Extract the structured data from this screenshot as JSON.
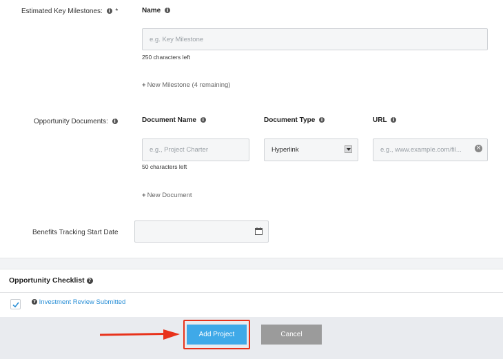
{
  "milestones": {
    "label": "Estimated Key Milestones:",
    "required_mark": "*",
    "name_header": "Name",
    "name_placeholder": "e.g. Key Milestone",
    "chars_left": "250 characters left",
    "new_link": "New Milestone (4 remaining)"
  },
  "documents": {
    "label": "Opportunity Documents:",
    "col_name": "Document Name",
    "col_type": "Document Type",
    "col_url": "URL",
    "name_placeholder": "e.g., Project Charter",
    "type_value": "Hyperlink",
    "url_placeholder": "e.g., www.example.com/fil...",
    "chars_left": "50 characters left",
    "new_link": "New Document"
  },
  "benefits": {
    "label": "Benefits Tracking Start Date",
    "value": ""
  },
  "checklist": {
    "title": "Opportunity Checklist",
    "items": [
      {
        "label": "Investment Review Submitted",
        "checked": true
      }
    ]
  },
  "actions": {
    "add_label": "Add Project",
    "cancel_label": "Cancel"
  },
  "colors": {
    "primary": "#3fa9e8",
    "cancel": "#9b9b9b",
    "annotation": "#e8321b",
    "link": "#2a8fd6"
  }
}
